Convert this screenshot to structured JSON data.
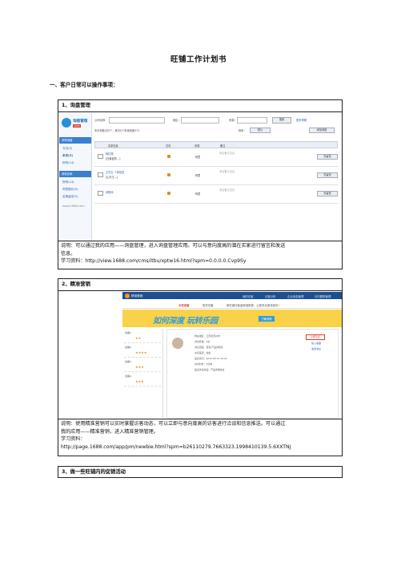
{
  "doc": {
    "title": "旺铺工作计划书",
    "subheading": "一、客户日常可以操作事项："
  },
  "section1": {
    "heading": "1、询盘管理",
    "note_line1": "说明：可以通过我的应用——询盘管理，进入询盘管理应用。可以与意向度高的潜在买家进行留言和发送",
    "note_line2": "信息。",
    "note_line3": "学习资料：http://view.1688.com/cms/itbu/xptw16.html?spm=0.0.0.0.Cvp9Sy",
    "screenshot": {
      "app_name": "询盘管理",
      "app_badge": "1688",
      "sidebar_cat1": "采购询盘",
      "sidebar_links1": [
        "今日(0)",
        "本月(3)",
        "所有(14)"
      ],
      "sidebar_cat2": "其他买家",
      "sidebar_links2": [
        "所有(14)",
        "同意报价(0)",
        "买家留言(5)"
      ],
      "sidebar_footer": "www.1688.com",
      "filter_company": "公司名称：",
      "filter_region": "地区：",
      "filter_source": "来源：",
      "search_btn": "搜索",
      "help_link": "更多帮助",
      "month_summary": "本月询盘(共3个，其中0个未读询盘0个)",
      "sort_label": "排序：",
      "sort_value": "默认",
      "add_btn": "添加询盘",
      "col_headers": [
        "买家信息",
        "意向",
        "来源",
        "备注"
      ],
      "rows": [
        {
          "name": "杨红艳",
          "detail": "[在普鑫的…]",
          "source": "阿里",
          "note": "添加备注信息",
          "action": "去留言"
        },
        {
          "name": "王先生 个体批发",
          "detail": "[山东王…]",
          "source": "阿里",
          "note": "添加备注信息",
          "action": "去留言"
        },
        {
          "name": "采购商",
          "detail": "",
          "source": "阿里",
          "note": "添加备注信息",
          "action": "去留言"
        }
      ]
    }
  },
  "section2": {
    "heading": "2、精准营销",
    "note_line1": "说明：使用精准营销可以实时掌握访客动态，可以立即与意向度高的访客进行洽谈和信息推送。可以通过",
    "note_line2": "我的应用——精准营销，进入精准营销管理。",
    "note_line3": "学习资料：",
    "note_line4": "http://page.1688.com/app/pm/newbie.html?spm=b26110279.7663323.1998410139.5.6XXTNJ",
    "screenshot": {
      "app_name": "精准营销",
      "top_tabs": [
        "我的访客",
        "访客分析",
        "企业信息管理",
        "访问跟踪管理"
      ],
      "sub_tabs": [
        "今日访客",
        "历史访客"
      ],
      "notice": "新旺铺访客量精准推荐，让更多买家找到你！",
      "banner_text": "如何深度 玩转乐园",
      "banner_btn": "了解详情",
      "visitors": [
        {
          "name": "访客1",
          "stars": "★★"
        },
        {
          "name": "访客2",
          "stars": "★★★★"
        },
        {
          "name": "访客3",
          "stars": "★★★"
        },
        {
          "name": "访客4",
          "stars": "★★★"
        }
      ],
      "card_lines": [
        "所在地区：江苏省苏州市",
        "浏览旺铺：3次",
        "浏览页面：首页/产品详情页",
        "访问来源：搜索",
        "最近访问：2015-05-12 16:43",
        "访问时长：5分钟",
        "最近浏览商品：产品详情信息"
      ],
      "card_btn1": "立即洽谈",
      "card_btn2": "加入收藏",
      "card_btn3": "发送消息"
    }
  },
  "section3": {
    "heading": "3、做一些旺铺内的促销活动"
  }
}
